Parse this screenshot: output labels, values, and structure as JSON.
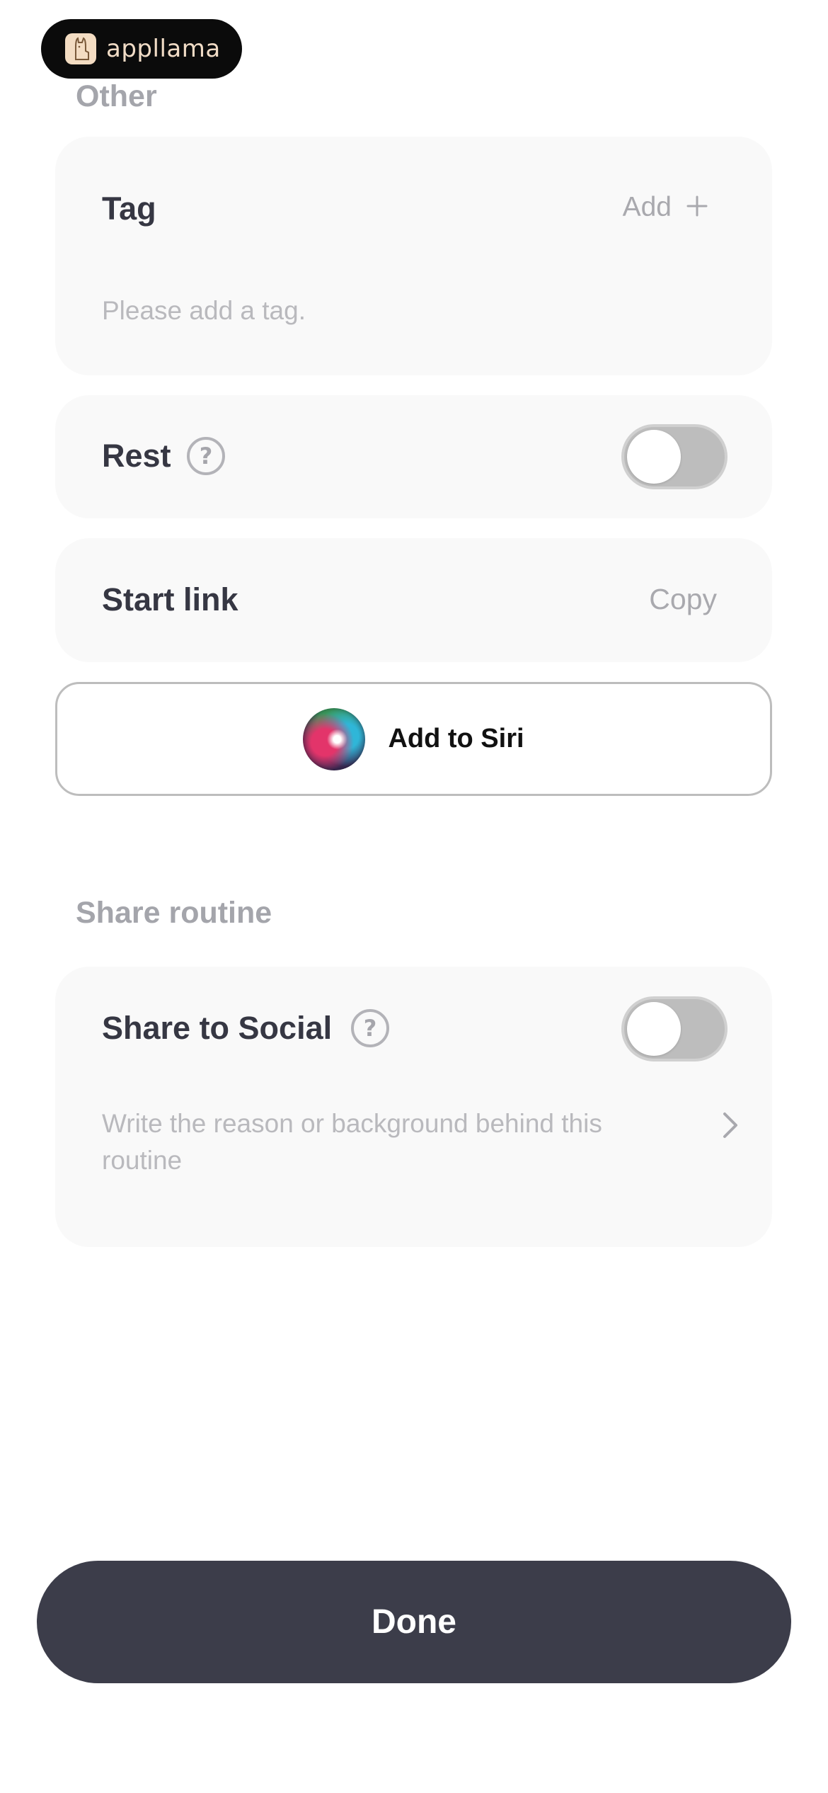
{
  "watermark": {
    "text": "appllama"
  },
  "sections": {
    "other": "Other",
    "share": "Share routine"
  },
  "tag": {
    "label": "Tag",
    "add_label": "Add",
    "placeholder": "Please add a tag."
  },
  "rest": {
    "label": "Rest",
    "help": "?",
    "enabled": false
  },
  "start_link": {
    "label": "Start link",
    "copy_label": "Copy"
  },
  "siri": {
    "label": "Add to Siri"
  },
  "share_social": {
    "label": "Share to Social",
    "help": "?",
    "enabled": false,
    "description_placeholder": "Write the reason or background behind this routine"
  },
  "footer": {
    "done_label": "Done"
  }
}
